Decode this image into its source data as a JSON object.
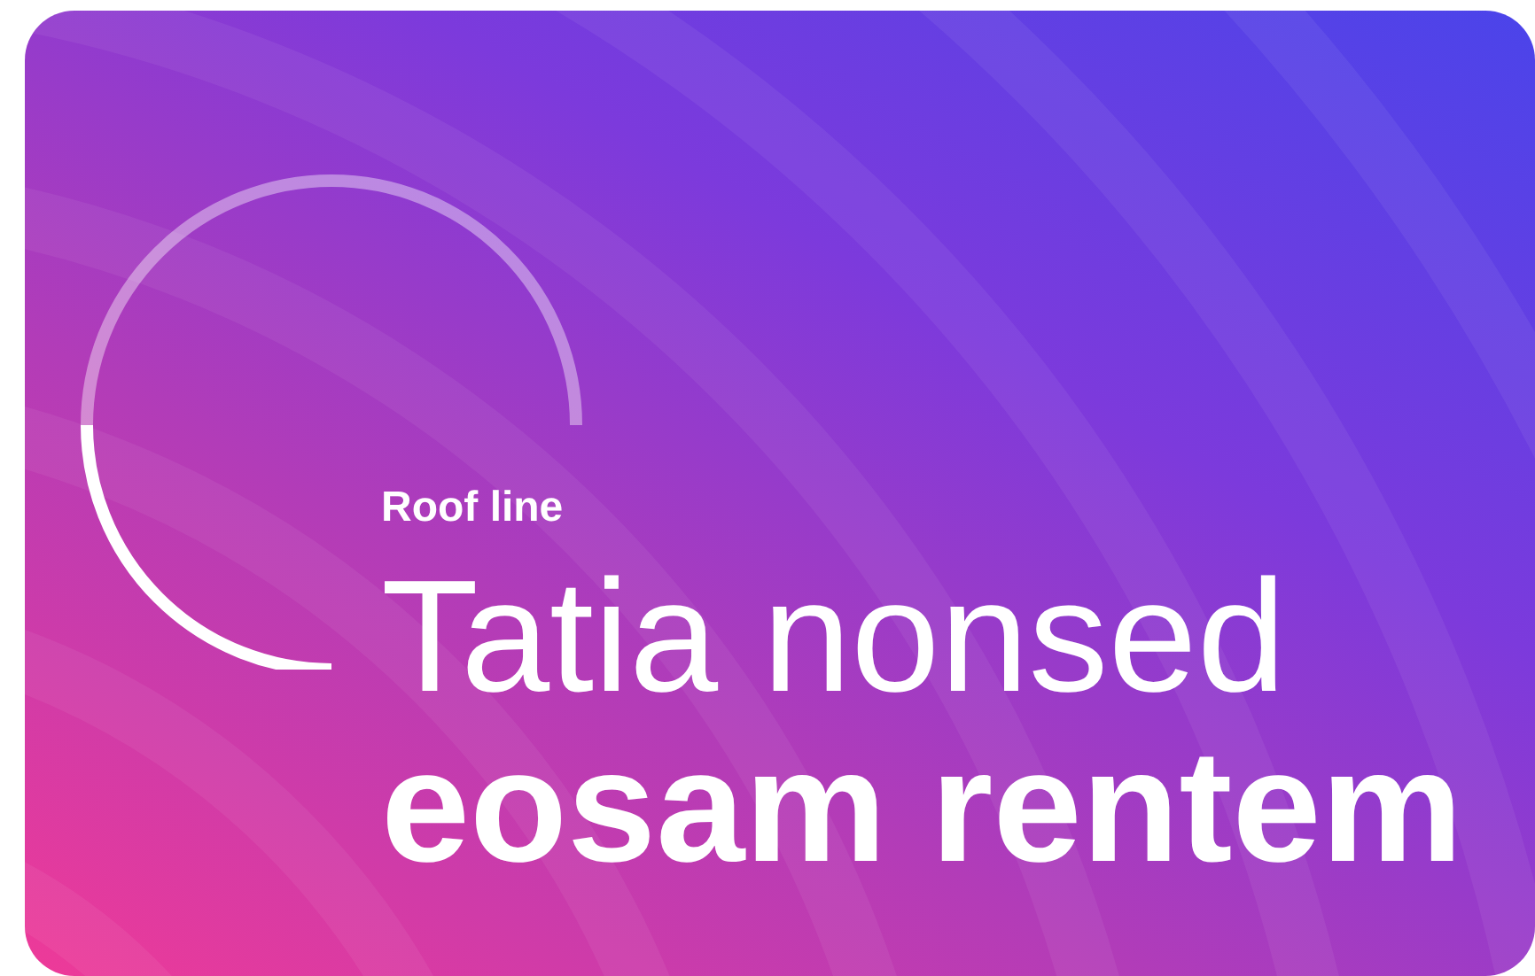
{
  "eyebrow": "Roof line",
  "headline": {
    "line_1": "Tatia nonsed",
    "line_2": "eosam rentem"
  }
}
